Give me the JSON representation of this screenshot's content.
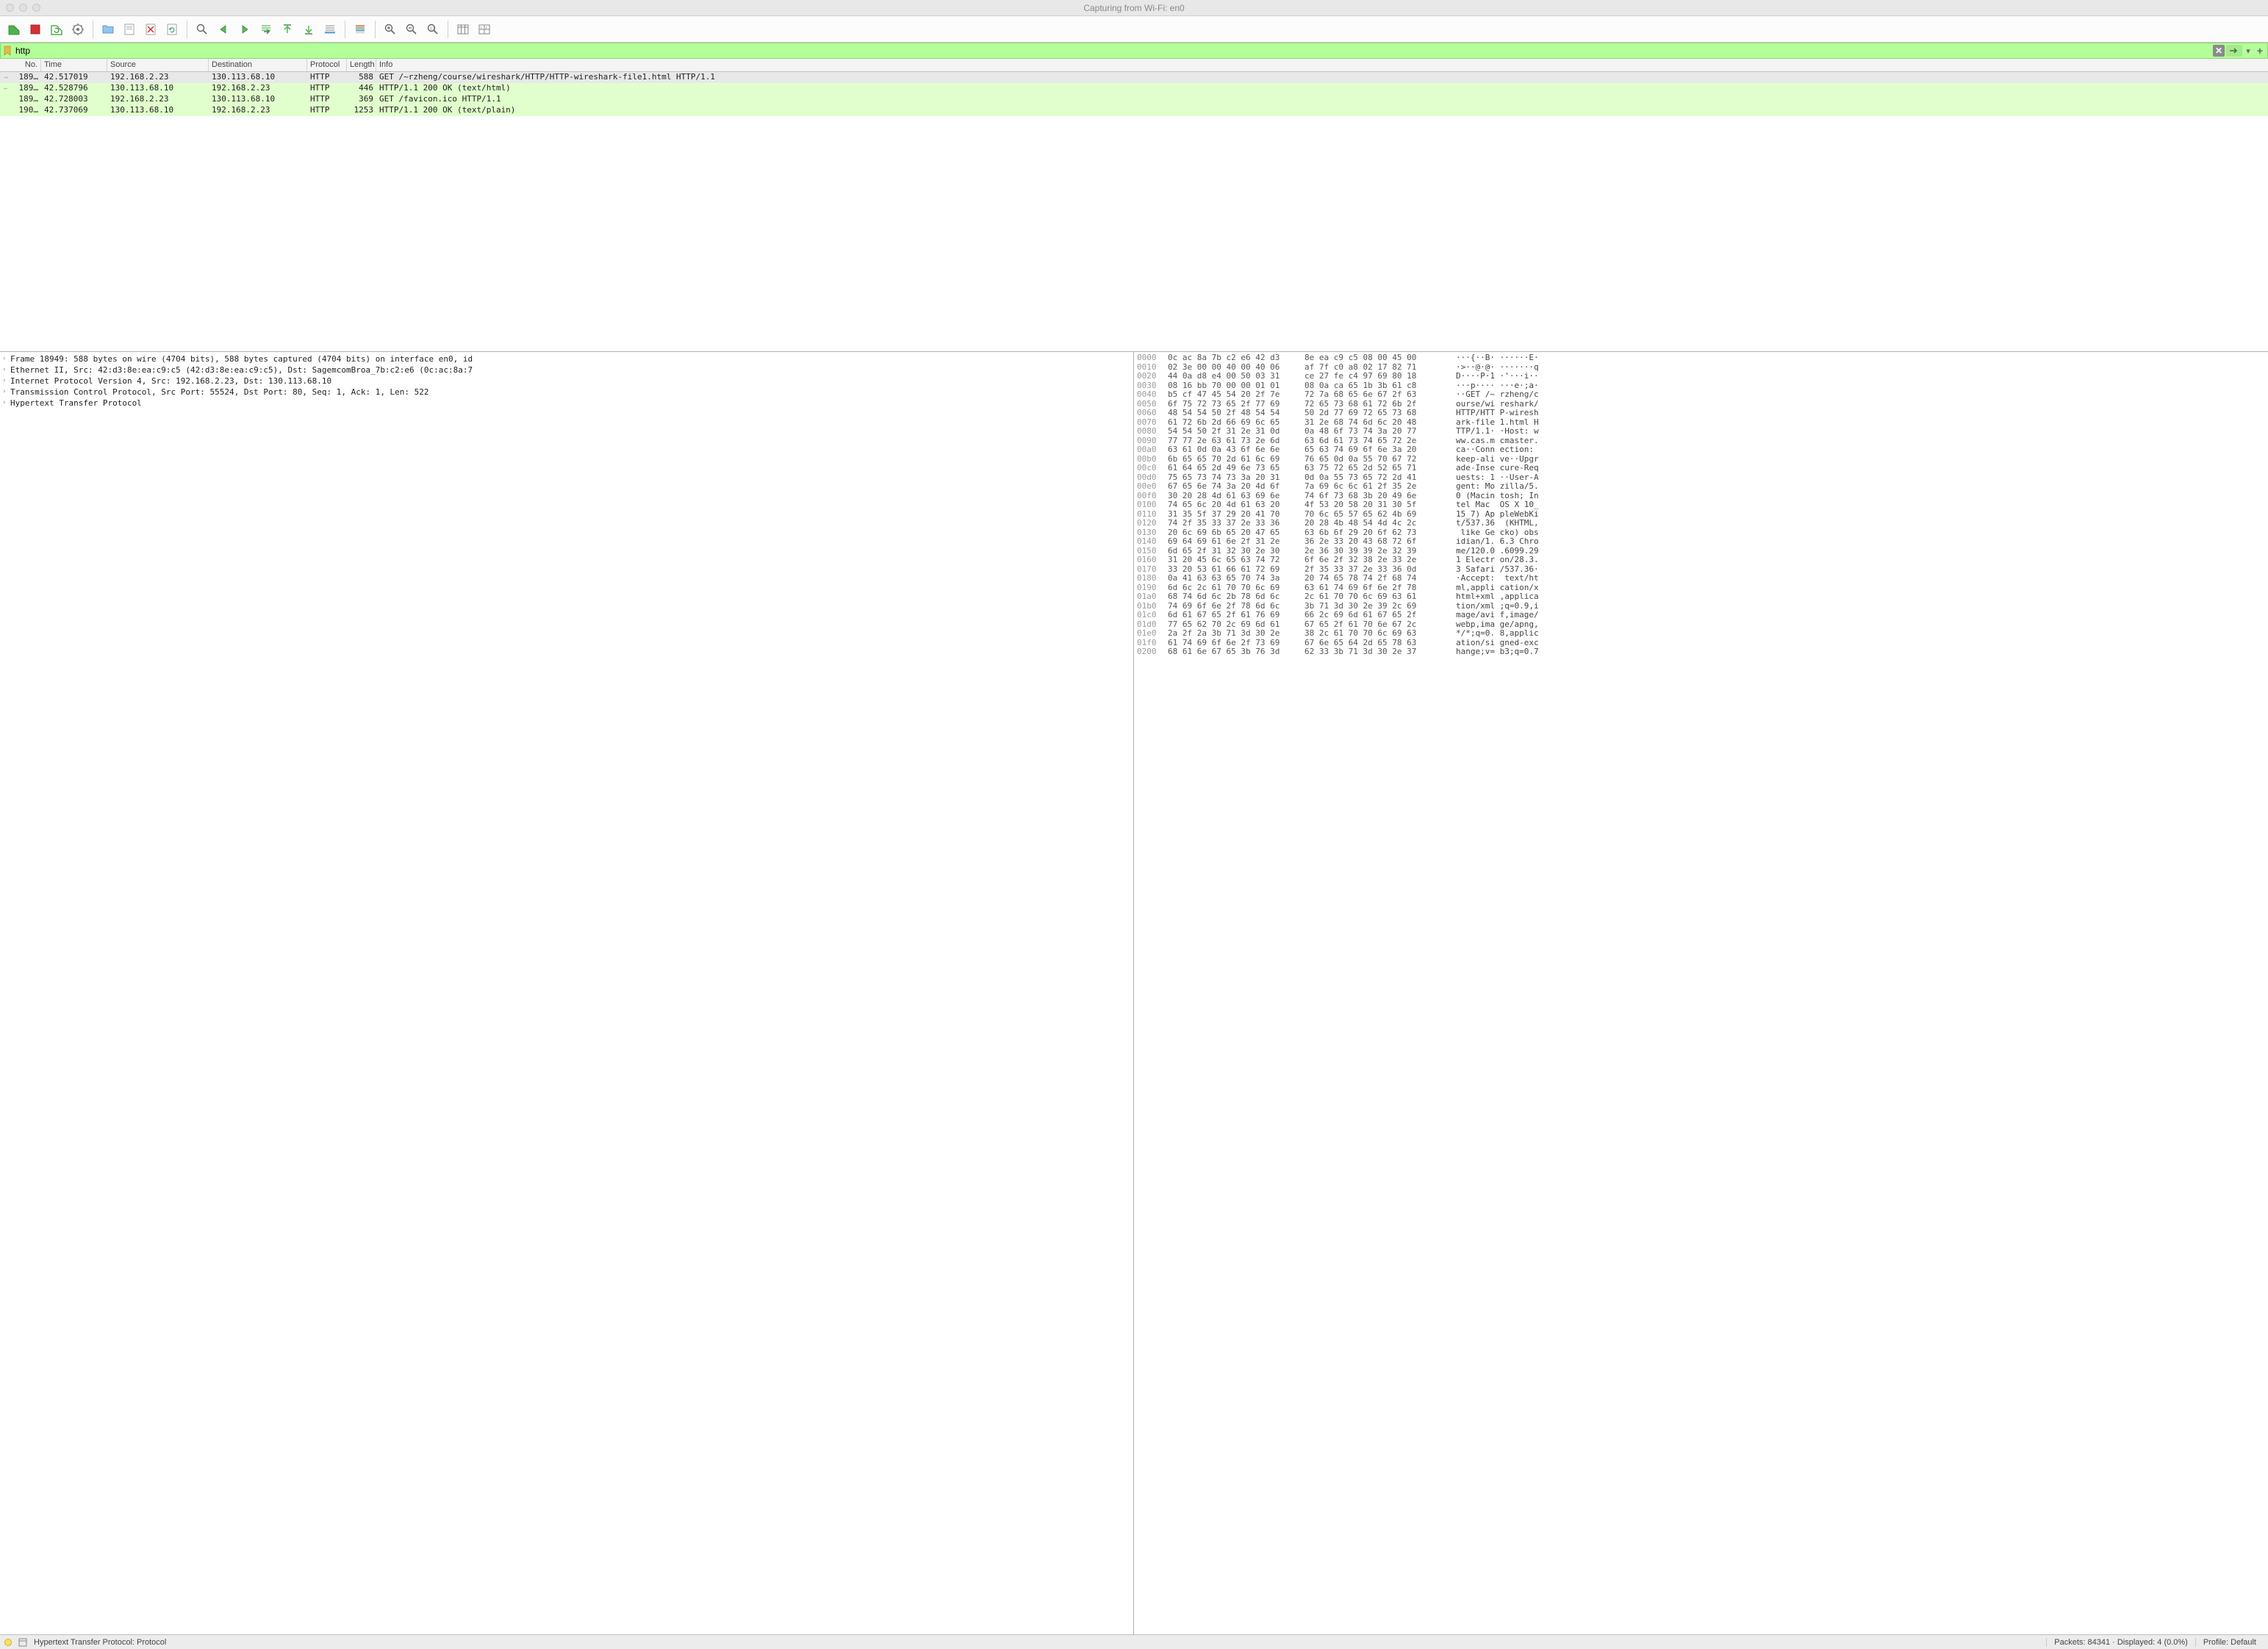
{
  "window": {
    "title": "Capturing from Wi-Fi: en0"
  },
  "filter": {
    "value": "http"
  },
  "columns": {
    "no": "No.",
    "time": "Time",
    "source": "Source",
    "destination": "Destination",
    "protocol": "Protocol",
    "length": "Length",
    "info": "Info"
  },
  "packets": [
    {
      "marker": "→",
      "no": "189…",
      "time": "42.517019",
      "src": "192.168.2.23",
      "dst": "130.113.68.10",
      "proto": "HTTP",
      "len": "588",
      "info": "GET /~rzheng/course/wireshark/HTTP/HTTP-wireshark-file1.html HTTP/1.1",
      "sel": true
    },
    {
      "marker": "←",
      "no": "189…",
      "time": "42.528796",
      "src": "130.113.68.10",
      "dst": "192.168.2.23",
      "proto": "HTTP",
      "len": "446",
      "info": "HTTP/1.1 200 OK  (text/html)",
      "ok": true
    },
    {
      "marker": "",
      "no": "189…",
      "time": "42.728003",
      "src": "192.168.2.23",
      "dst": "130.113.68.10",
      "proto": "HTTP",
      "len": "369",
      "info": "GET /favicon.ico HTTP/1.1",
      "ok": true
    },
    {
      "marker": "",
      "no": "190…",
      "time": "42.737069",
      "src": "130.113.68.10",
      "dst": "192.168.2.23",
      "proto": "HTTP",
      "len": "1253",
      "info": "HTTP/1.1 200 OK  (text/plain)",
      "ok": true
    }
  ],
  "details": [
    "Frame 18949: 588 bytes on wire (4704 bits), 588 bytes captured (4704 bits) on interface en0, id",
    "Ethernet II, Src: 42:d3:8e:ea:c9:c5 (42:d3:8e:ea:c9:c5), Dst: SagemcomBroa_7b:c2:e6 (0c:ac:8a:7",
    "Internet Protocol Version 4, Src: 192.168.2.23, Dst: 130.113.68.10",
    "Transmission Control Protocol, Src Port: 55524, Dst Port: 80, Seq: 1, Ack: 1, Len: 522",
    "Hypertext Transfer Protocol"
  ],
  "hex": [
    {
      "off": "0000",
      "b1": "0c ac 8a 7b c2 e6 42 d3",
      "b2": "8e ea c9 c5 08 00 45 00",
      "a": "···{··B· ······E·"
    },
    {
      "off": "0010",
      "b1": "02 3e 00 00 40 00 40 06",
      "b2": "af 7f c0 a8 02 17 82 71",
      "a": "·>··@·@· ·······q"
    },
    {
      "off": "0020",
      "b1": "44 0a d8 e4 00 50 03 31",
      "b2": "ce 27 fe c4 97 69 80 18",
      "a": "D····P·1 ·'···i··"
    },
    {
      "off": "0030",
      "b1": "08 16 bb 70 00 00 01 01",
      "b2": "08 0a ca 65 1b 3b 61 c8",
      "a": "···p···· ···e·;a·"
    },
    {
      "off": "0040",
      "b1": "b5 cf 47 45 54 20 2f 7e",
      "b2": "72 7a 68 65 6e 67 2f 63",
      "a": "··GET /~ rzheng/c"
    },
    {
      "off": "0050",
      "b1": "6f 75 72 73 65 2f 77 69",
      "b2": "72 65 73 68 61 72 6b 2f",
      "a": "ourse/wi reshark/"
    },
    {
      "off": "0060",
      "b1": "48 54 54 50 2f 48 54 54",
      "b2": "50 2d 77 69 72 65 73 68",
      "a": "HTTP/HTT P-wiresh"
    },
    {
      "off": "0070",
      "b1": "61 72 6b 2d 66 69 6c 65",
      "b2": "31 2e 68 74 6d 6c 20 48",
      "a": "ark-file 1.html H"
    },
    {
      "off": "0080",
      "b1": "54 54 50 2f 31 2e 31 0d",
      "b2": "0a 48 6f 73 74 3a 20 77",
      "a": "TTP/1.1· ·Host: w"
    },
    {
      "off": "0090",
      "b1": "77 77 2e 63 61 73 2e 6d",
      "b2": "63 6d 61 73 74 65 72 2e",
      "a": "ww.cas.m cmaster."
    },
    {
      "off": "00a0",
      "b1": "63 61 0d 0a 43 6f 6e 6e",
      "b2": "65 63 74 69 6f 6e 3a 20",
      "a": "ca··Conn ection: "
    },
    {
      "off": "00b0",
      "b1": "6b 65 65 70 2d 61 6c 69",
      "b2": "76 65 0d 0a 55 70 67 72",
      "a": "keep-ali ve··Upgr"
    },
    {
      "off": "00c0",
      "b1": "61 64 65 2d 49 6e 73 65",
      "b2": "63 75 72 65 2d 52 65 71",
      "a": "ade-Inse cure-Req"
    },
    {
      "off": "00d0",
      "b1": "75 65 73 74 73 3a 20 31",
      "b2": "0d 0a 55 73 65 72 2d 41",
      "a": "uests: 1 ··User-A"
    },
    {
      "off": "00e0",
      "b1": "67 65 6e 74 3a 20 4d 6f",
      "b2": "7a 69 6c 6c 61 2f 35 2e",
      "a": "gent: Mo zilla/5."
    },
    {
      "off": "00f0",
      "b1": "30 20 28 4d 61 63 69 6e",
      "b2": "74 6f 73 68 3b 20 49 6e",
      "a": "0 (Macin tosh; In"
    },
    {
      "off": "0100",
      "b1": "74 65 6c 20 4d 61 63 20",
      "b2": "4f 53 20 58 20 31 30 5f",
      "a": "tel Mac  OS X 10_"
    },
    {
      "off": "0110",
      "b1": "31 35 5f 37 29 20 41 70",
      "b2": "70 6c 65 57 65 62 4b 69",
      "a": "15_7) Ap pleWebKi"
    },
    {
      "off": "0120",
      "b1": "74 2f 35 33 37 2e 33 36",
      "b2": "20 28 4b 48 54 4d 4c 2c",
      "a": "t/537.36  (KHTML,"
    },
    {
      "off": "0130",
      "b1": "20 6c 69 6b 65 20 47 65",
      "b2": "63 6b 6f 29 20 6f 62 73",
      "a": " like Ge cko) obs"
    },
    {
      "off": "0140",
      "b1": "69 64 69 61 6e 2f 31 2e",
      "b2": "36 2e 33 20 43 68 72 6f",
      "a": "idian/1. 6.3 Chro"
    },
    {
      "off": "0150",
      "b1": "6d 65 2f 31 32 30 2e 30",
      "b2": "2e 36 30 39 39 2e 32 39",
      "a": "me/120.0 .6099.29"
    },
    {
      "off": "0160",
      "b1": "31 20 45 6c 65 63 74 72",
      "b2": "6f 6e 2f 32 38 2e 33 2e",
      "a": "1 Electr on/28.3."
    },
    {
      "off": "0170",
      "b1": "33 20 53 61 66 61 72 69",
      "b2": "2f 35 33 37 2e 33 36 0d",
      "a": "3 Safari /537.36·"
    },
    {
      "off": "0180",
      "b1": "0a 41 63 63 65 70 74 3a",
      "b2": "20 74 65 78 74 2f 68 74",
      "a": "·Accept:  text/ht"
    },
    {
      "off": "0190",
      "b1": "6d 6c 2c 61 70 70 6c 69",
      "b2": "63 61 74 69 6f 6e 2f 78",
      "a": "ml,appli cation/x"
    },
    {
      "off": "01a0",
      "b1": "68 74 6d 6c 2b 78 6d 6c",
      "b2": "2c 61 70 70 6c 69 63 61",
      "a": "html+xml ,applica"
    },
    {
      "off": "01b0",
      "b1": "74 69 6f 6e 2f 78 6d 6c",
      "b2": "3b 71 3d 30 2e 39 2c 69",
      "a": "tion/xml ;q=0.9,i"
    },
    {
      "off": "01c0",
      "b1": "6d 61 67 65 2f 61 76 69",
      "b2": "66 2c 69 6d 61 67 65 2f",
      "a": "mage/avi f,image/"
    },
    {
      "off": "01d0",
      "b1": "77 65 62 70 2c 69 6d 61",
      "b2": "67 65 2f 61 70 6e 67 2c",
      "a": "webp,ima ge/apng,"
    },
    {
      "off": "01e0",
      "b1": "2a 2f 2a 3b 71 3d 30 2e",
      "b2": "38 2c 61 70 70 6c 69 63",
      "a": "*/*;q=0. 8,applic"
    },
    {
      "off": "01f0",
      "b1": "61 74 69 6f 6e 2f 73 69",
      "b2": "67 6e 65 64 2d 65 78 63",
      "a": "ation/si gned-exc"
    },
    {
      "off": "0200",
      "b1": "68 61 6e 67 65 3b 76 3d",
      "b2": "62 33 3b 71 3d 30 2e 37",
      "a": "hange;v= b3;q=0.7"
    }
  ],
  "status": {
    "left": "Hypertext Transfer Protocol: Protocol",
    "packets": "Packets: 84341 · Displayed: 4 (0.0%)",
    "profile": "Profile: Default"
  }
}
